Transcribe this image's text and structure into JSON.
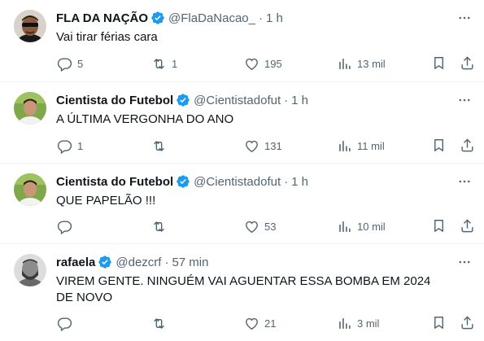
{
  "tweets": [
    {
      "name": "FLA DA NAÇÃO",
      "handle": "@FlaDaNacao_",
      "time": "1 h",
      "text": "Vai tirar férias cara",
      "replies": "5",
      "retweets": "1",
      "likes": "195",
      "views": "13 mil",
      "avatar": "avatar-man-sunglasses"
    },
    {
      "name": "Cientista do Futebol",
      "handle": "@Cientistadofut",
      "time": "1 h",
      "text": "A ÚLTIMA VERGONHA DO ANO",
      "replies": "1",
      "retweets": "",
      "likes": "131",
      "views": "11 mil",
      "avatar": "avatar-man-green"
    },
    {
      "name": "Cientista do Futebol",
      "handle": "@Cientistadofut",
      "time": "1 h",
      "text": "QUE PAPELÃO !!!",
      "replies": "",
      "retweets": "",
      "likes": "53",
      "views": "10 mil",
      "avatar": "avatar-man-green"
    },
    {
      "name": "rafaela",
      "handle": "@dezcrf",
      "time": "57 min",
      "text": "VIREM GENTE. NINGUÉM VAI AGUENTAR ESSA BOMBA EM 2024 DE NOVO",
      "replies": "",
      "retweets": "",
      "likes": "21",
      "views": "3 mil",
      "avatar": "avatar-bearded-man"
    }
  ],
  "colors": {
    "verified": "#1d9bf0",
    "muted": "#536471",
    "text": "#0f1419",
    "divider": "#eff3f4"
  },
  "dot": "·"
}
